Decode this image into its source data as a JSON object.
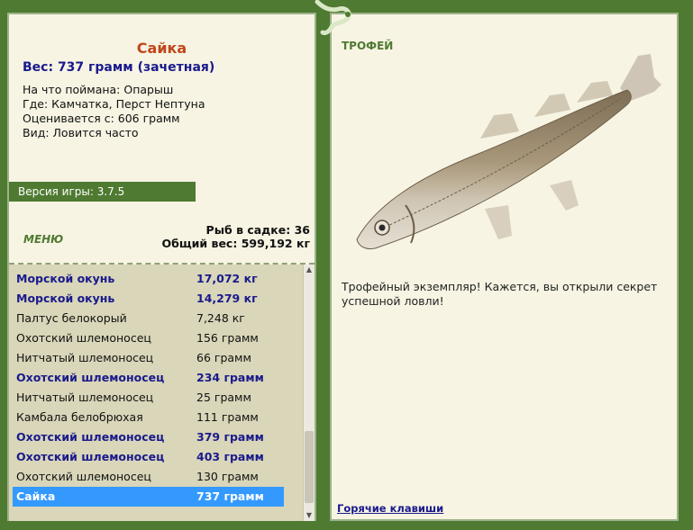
{
  "fish": {
    "name": "Сайка",
    "weight_line": "Вес: 737 грамм (зачетная)",
    "caught_on": "На что поймана: Опарыш",
    "where": "Где: Камчатка, Перст Нептуна",
    "rated_from": "Оценивается с: 606 грамм",
    "kind": "Вид: Ловится часто"
  },
  "version": "Версия игры: 3.7.5",
  "menu": {
    "label": "МЕНЮ"
  },
  "keepnet": {
    "count_line": "Рыб в садке: 36",
    "total_line": "Общий вес: 599,192 кг"
  },
  "list": [
    {
      "name": "Морской окунь",
      "weight": "17,072 кг",
      "bold": true
    },
    {
      "name": "Морской окунь",
      "weight": "14,279 кг",
      "bold": true
    },
    {
      "name": "Палтус белокорый",
      "weight": "7,248 кг",
      "bold": false
    },
    {
      "name": "Охотский шлемоносец",
      "weight": "156 грамм",
      "bold": false
    },
    {
      "name": "Нитчатый шлемоносец",
      "weight": "66 грамм",
      "bold": false
    },
    {
      "name": "Охотский шлемоносец",
      "weight": "234 грамм",
      "bold": true
    },
    {
      "name": "Нитчатый шлемоносец",
      "weight": "25 грамм",
      "bold": false
    },
    {
      "name": "Камбала белобрюхая",
      "weight": "111 грамм",
      "bold": false
    },
    {
      "name": "Охотский шлемоносец",
      "weight": "379 грамм",
      "bold": true
    },
    {
      "name": "Охотский шлемоносец",
      "weight": "403 грамм",
      "bold": true
    },
    {
      "name": "Охотский шлемоносец",
      "weight": "130 грамм",
      "bold": false
    },
    {
      "name": "Сайка",
      "weight": "737 грамм",
      "bold": true,
      "selected": true
    }
  ],
  "trophy": {
    "title": "ТРОФЕЙ",
    "text": "Трофейный экземпляр! Кажется, вы открыли секрет успешной ловли!"
  },
  "hotkeys": "Горячие клавиши",
  "colors": {
    "accent_green": "#4f7a31",
    "panel_bg": "#f7f4e3",
    "list_bg": "#d9d6b9",
    "selected": "#3399ff",
    "link_blue": "#1a1a8c",
    "name_orange": "#c0471b"
  },
  "icons": {
    "fish_image": "saika-fish-image",
    "decoration": "lizard-decoration"
  }
}
